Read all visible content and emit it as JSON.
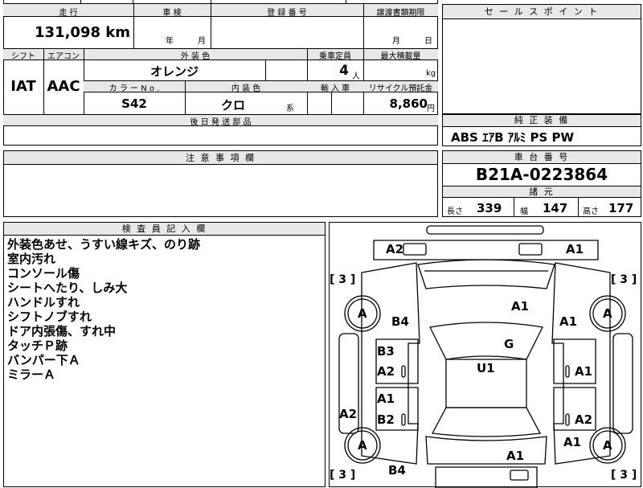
{
  "info": {
    "mileage_label": "走 行",
    "mileage_value": "131,098 km",
    "inspection_label": "車 検",
    "inspection_year": "年",
    "inspection_month": "月",
    "registration_label": "登 録 番 号",
    "transfer_label": "譲渡書類期限",
    "transfer_month": "月",
    "transfer_day": "日",
    "shift_label": "シフト",
    "aircon_label": "エアコン",
    "exterior_label": "外 装 色",
    "capacity_label": "乗車定員",
    "maxload_label": "最大積載量",
    "shift_value": "IAT",
    "aircon_value": "AAC",
    "exterior_value": "オレンジ",
    "capacity_value": "4",
    "capacity_unit": "人",
    "maxload_unit": "kg",
    "colorno_label": "カ ラ ー N o .",
    "interior_label": "内 装 色",
    "import_label": "輸 入 車",
    "recycle_label": "リサイクル預託金",
    "colorno_value": "S42",
    "interior_value": "クロ",
    "interior_suffix": "系",
    "recycle_value": "8,860",
    "recycle_unit": "円",
    "later_parts_label": "後 日 発 送 部 品"
  },
  "sales": {
    "title": "セ ー ル ス ポ イ ン ト",
    "equipment_label": "純 正 装 備",
    "equipment_value": "ABS ｴｱB ｱﾙﾐ PS PW"
  },
  "notes": {
    "title": "注 意 事 項 欄"
  },
  "chassis": {
    "title": "車 台 番 号",
    "value": "B21A-0223864",
    "spec_title": "諸 元",
    "length_label": "長さ",
    "length_value": "339",
    "width_label": "幅",
    "width_value": "147",
    "height_label": "高さ",
    "height_value": "177"
  },
  "inspector": {
    "title": "検 査 員 記 入 欄",
    "lines": [
      "外装色あせ、うすい線キズ、のり跡",
      "室内汚れ",
      "コンソール傷",
      "シートへたり、しみ大",
      "ハンドルすれ",
      "シフトノブすれ",
      "ドア内張傷、すれ中",
      "タッチＰ跡",
      "バンパー下Ａ",
      "ミラーＡ"
    ]
  },
  "diagram": {
    "bracket_tl": "[ 3 ]",
    "bracket_tr": "[ 3 ]",
    "bracket_bl": "[ 3 ]",
    "bracket_br": "[ 3 ]",
    "wheel_fl": "A",
    "wheel_fr": "A",
    "wheel_rl": "A",
    "wheel_rr": "A",
    "a2_front_left": "A2",
    "a1_front_right": "A1",
    "a1_hood": "A1",
    "b4_front_left": "B4",
    "a1_front_fender_right": "A1",
    "g_windshield": "G",
    "b3_door_left": "B3",
    "a2_door_left": "A2",
    "u1_roof": "U1",
    "a1_door_right": "A1",
    "a1_rear_door_left": "A1",
    "b2_rear_door_left": "B2",
    "a2_rear_door_right": "A2",
    "a2_side_left": "A2",
    "a1_rear_right": "A1",
    "a1_rear": "A1",
    "b4_rear_left": "B4"
  }
}
